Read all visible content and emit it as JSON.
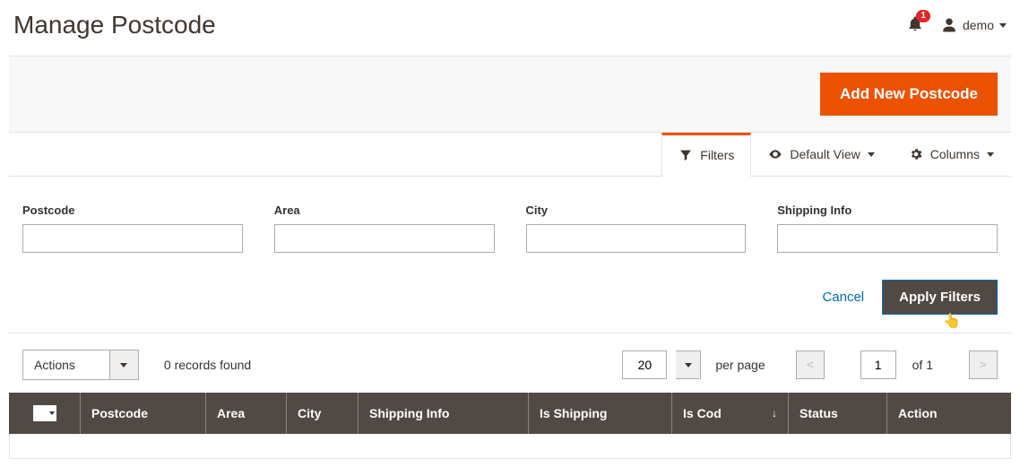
{
  "header": {
    "title": "Manage Postcode",
    "notif_count": "1",
    "user_label": "demo"
  },
  "action_bar": {
    "add_label": "Add New Postcode"
  },
  "toolbar": {
    "filters_label": "Filters",
    "default_view_label": "Default View",
    "columns_label": "Columns"
  },
  "filters": {
    "postcode": {
      "label": "Postcode",
      "value": ""
    },
    "area": {
      "label": "Area",
      "value": ""
    },
    "city": {
      "label": "City",
      "value": ""
    },
    "shipping_info": {
      "label": "Shipping Info",
      "value": ""
    },
    "cancel_label": "Cancel",
    "apply_label": "Apply Filters"
  },
  "controls": {
    "actions_label": "Actions",
    "records_found": "0 records found",
    "per_page_value": "20",
    "per_page_label": "per page",
    "page_value": "1",
    "page_of": "of 1"
  },
  "grid_headers": {
    "postcode": "Postcode",
    "area": "Area",
    "city": "City",
    "shipping_info": "Shipping Info",
    "is_shipping": "Is Shipping",
    "is_cod": "Is Cod",
    "status": "Status",
    "action": "Action"
  }
}
